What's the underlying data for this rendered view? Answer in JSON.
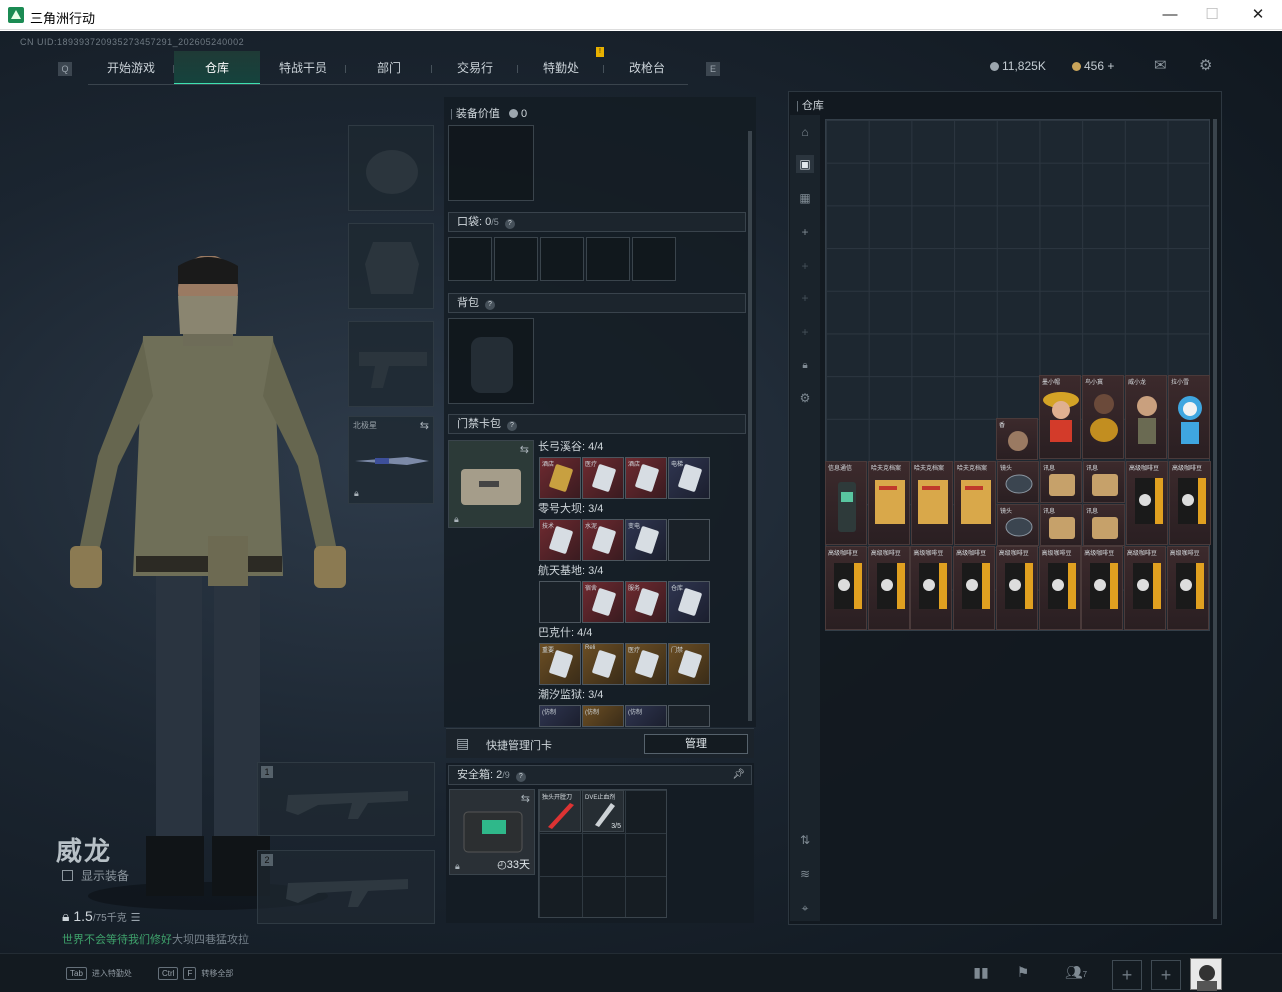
{
  "window": {
    "title": "三角洲行动",
    "minimize": "—",
    "maximize": "☐",
    "close": "✕"
  },
  "uid": "CN UID:189393720935273457291_202605240002",
  "nav": {
    "tabs": [
      "开始游戏",
      "仓库",
      "特战干员",
      "部门",
      "交易行",
      "特勤处",
      "改枪台"
    ],
    "active": "仓库",
    "notice_badge": "!"
  },
  "currency": {
    "coins": "11,825K",
    "coupons": "456",
    "plus": "+"
  },
  "character": {
    "name": "威龙",
    "show_equipment": "显示装备",
    "weight": "1.5",
    "weight_max": "/75千克",
    "tip_green": "世界不会等待我们修好",
    "tip_grey": "大坝四巷猛攻拉"
  },
  "equipment": {
    "melee_label": "北极星",
    "weapon_slots": [
      "1",
      "2"
    ]
  },
  "middle": {
    "value_label": "装备价值",
    "value": "0",
    "pocket_label": "口袋:",
    "pocket_count": "0",
    "pocket_max": "/5",
    "backpack_label": "背包",
    "keycard_label": "门禁卡包",
    "maps": [
      {
        "name": "长弓溪谷: 4/4",
        "cards": [
          "酒店",
          "医疗",
          "酒店",
          "电梯"
        ]
      },
      {
        "name": "零号大坝: 3/4",
        "cards": [
          "技术",
          "水泥",
          "变电",
          ""
        ]
      },
      {
        "name": "航天基地: 3/4",
        "cards": [
          "",
          "宿舍",
          "服务",
          "仓库"
        ]
      },
      {
        "name": "巴克什: 4/4",
        "cards": [
          "重要",
          "Reli",
          "医疗",
          "门禁"
        ]
      },
      {
        "name": "潮汐监狱: 3/4",
        "cards": [
          "(仿制",
          "(仿制",
          "(仿制",
          ""
        ]
      }
    ],
    "quick_manage": "快捷管理门卡",
    "manage_button": "管理",
    "safe_label": "安全箱:",
    "safe_count": "2",
    "safe_max": "/9",
    "safe_days": "33天",
    "safe_items": [
      {
        "name": "独头开膛刀",
        "count": ""
      },
      {
        "name": "DVE止血剂",
        "count": "3/5"
      }
    ]
  },
  "warehouse": {
    "title": "仓库",
    "items": [
      {
        "name": "墨小帽",
        "kind": "figure"
      },
      {
        "name": "鸟小冀",
        "kind": "figure"
      },
      {
        "name": "威小龙",
        "kind": "figure"
      },
      {
        "name": "拉小雪",
        "kind": "figure"
      },
      {
        "name": "香",
        "kind": "figure-small"
      },
      {
        "name": "信息通信",
        "kind": "radio"
      },
      {
        "name": "哈夫克档案",
        "kind": "folder"
      },
      {
        "name": "哈夫克档案",
        "kind": "folder"
      },
      {
        "name": "哈夫克档案",
        "kind": "folder"
      },
      {
        "name": "镜头",
        "kind": "lens"
      },
      {
        "name": "讯息",
        "kind": "bag"
      },
      {
        "name": "讯息",
        "kind": "bag"
      },
      {
        "name": "高级咖啡豆",
        "kind": "coffee"
      },
      {
        "name": "高级咖啡豆",
        "kind": "coffee"
      }
    ],
    "coffee_label": "高级咖啡豆"
  },
  "bottombar": {
    "hint1_key": "Tab",
    "hint1": "进入特勤处",
    "hint2_key": "Ctrl",
    "hint2_key2": "F",
    "hint2": "转移全部",
    "friends_count": "7"
  }
}
